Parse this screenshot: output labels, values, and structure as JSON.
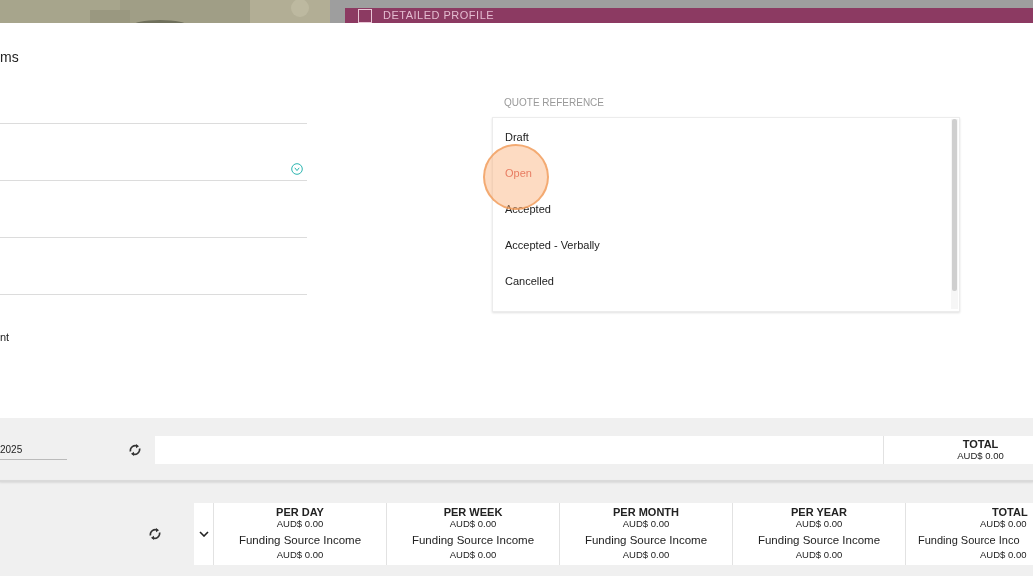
{
  "background": {
    "banner": {
      "title": "DETAILED PROFILE"
    }
  },
  "modal": {
    "title": "ms",
    "fields": [
      {
        "kind": "text"
      },
      {
        "kind": "select"
      },
      {
        "kind": "text"
      },
      {
        "kind": "text"
      }
    ],
    "note": "nt",
    "quote_reference": {
      "label": "QUOTE REFERENCE",
      "options": [
        {
          "label": "Draft",
          "selected": false
        },
        {
          "label": "Open",
          "selected": true
        },
        {
          "label": "Accepted",
          "selected": false
        },
        {
          "label": "Accepted - Verbally",
          "selected": false
        },
        {
          "label": "Cancelled",
          "selected": false
        }
      ]
    }
  },
  "date_bar": {
    "date": "2025",
    "total": {
      "label": "TOTAL",
      "amount": "AUD$ 0.00"
    }
  },
  "summary": {
    "columns": [
      {
        "period": "PER DAY",
        "amount": "AUD$ 0.00",
        "income_label": "Funding Source Income",
        "income_amount": "AUD$ 0.00"
      },
      {
        "period": "PER WEEK",
        "amount": "AUD$ 0.00",
        "income_label": "Funding Source Income",
        "income_amount": "AUD$ 0.00"
      },
      {
        "period": "PER MONTH",
        "amount": "AUD$ 0.00",
        "income_label": "Funding Source Income",
        "income_amount": "AUD$ 0.00"
      },
      {
        "period": "PER YEAR",
        "amount": "AUD$ 0.00",
        "income_label": "Funding Source Income",
        "income_amount": "AUD$ 0.00"
      },
      {
        "period": "TOTAL",
        "amount": "AUD$ 0.00",
        "income_label": "Funding Source Inco",
        "income_amount": "AUD$ 0.00"
      }
    ]
  }
}
